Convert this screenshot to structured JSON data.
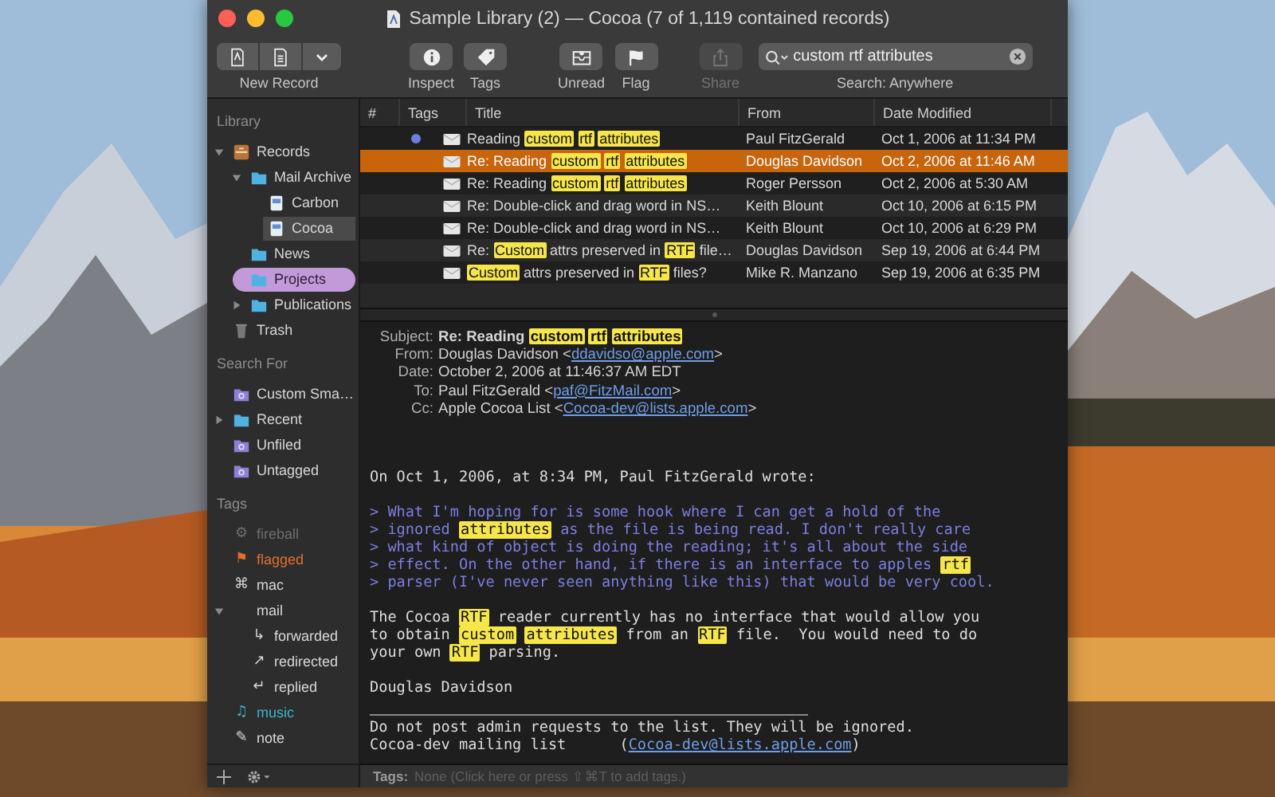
{
  "window": {
    "title": "Sample Library (2) — Cocoa (7 of 1,119 contained records)"
  },
  "toolbar": {
    "new_record": {
      "label": "New Record"
    },
    "buttons": [
      {
        "kind": "inspect",
        "label": "Inspect",
        "disabled": false
      },
      {
        "kind": "tags",
        "label": "Tags",
        "disabled": false
      },
      {
        "kind": "unread",
        "label": "Unread",
        "disabled": false
      },
      {
        "kind": "flag",
        "label": "Flag",
        "disabled": false
      },
      {
        "kind": "share",
        "label": "Share",
        "disabled": true
      }
    ],
    "search": {
      "value": "custom rtf attributes",
      "scope": "Search: Anywhere"
    }
  },
  "sidebar": {
    "sections": [
      {
        "title": "Library",
        "items": [
          {
            "label": "Records",
            "kind": "records",
            "expanded": true,
            "selected": false,
            "children": [
              {
                "label": "Mail Archive",
                "kind": "folder",
                "expanded": true,
                "selected": false,
                "children": [
                  {
                    "label": "Carbon",
                    "kind": "mailbox",
                    "selected": false
                  },
                  {
                    "label": "Cocoa",
                    "kind": "mailbox",
                    "selected": true
                  }
                ]
              },
              {
                "label": "News",
                "kind": "folder",
                "selected": false
              },
              {
                "label": "Projects",
                "kind": "folder",
                "selected": false,
                "color": "#c39ad9"
              },
              {
                "label": "Publications",
                "kind": "folder",
                "expanded": false,
                "selected": false
              }
            ]
          },
          {
            "label": "Trash",
            "kind": "trash",
            "selected": false
          }
        ]
      },
      {
        "title": "Search For",
        "items": [
          {
            "label": "Custom Sma…",
            "kind": "smart",
            "selected": false
          },
          {
            "label": "Recent",
            "kind": "folder",
            "expanded": false,
            "selected": false
          },
          {
            "label": "Unfiled",
            "kind": "smart",
            "selected": false
          },
          {
            "label": "Untagged",
            "kind": "smart",
            "selected": false
          }
        ]
      },
      {
        "title": "Tags",
        "items": [
          {
            "label": "fireball",
            "kind": "tag",
            "glyph": "⚙",
            "color": "#6e6e6e",
            "selected": false
          },
          {
            "label": "flagged",
            "kind": "tag",
            "glyph": "⚑",
            "color": "#e0702a",
            "selected": false
          },
          {
            "label": "mac",
            "kind": "tag",
            "glyph": "⌘",
            "color": "#d8d8d8",
            "selected": false
          },
          {
            "label": "mail",
            "kind": "tag",
            "color": "#d8d8d8",
            "expanded": true,
            "selected": false,
            "children": [
              {
                "label": "forwarded",
                "kind": "tag",
                "glyph": "↳",
                "color": "#d8d8d8",
                "selected": false
              },
              {
                "label": "redirected",
                "kind": "tag",
                "glyph": "↗",
                "color": "#d8d8d8",
                "selected": false
              },
              {
                "label": "replied",
                "kind": "tag",
                "glyph": "↵",
                "color": "#d8d8d8",
                "selected": false
              }
            ]
          },
          {
            "label": "music",
            "kind": "tag",
            "glyph": "♫",
            "color": "#3bb8c9",
            "selected": false
          },
          {
            "label": "note",
            "kind": "tag",
            "glyph": "✎",
            "color": "#d8d8d8",
            "selected": false
          }
        ]
      }
    ]
  },
  "table": {
    "columns": [
      "#",
      "Tags",
      "Title",
      "From",
      "Date Modified"
    ],
    "rows": [
      {
        "unread": true,
        "selected": false,
        "title": [
          {
            "text": "Reading ",
            "kind": "plain"
          },
          {
            "text": "custom ",
            "kind": "highlight"
          },
          {
            "text": "rtf ",
            "kind": "highlight"
          },
          {
            "text": "attributes",
            "kind": "highlight"
          }
        ],
        "from": "Paul FitzGerald",
        "date": "Oct 1, 2006 at 11:34 PM"
      },
      {
        "unread": false,
        "selected": true,
        "title": [
          {
            "text": "Re: Reading ",
            "kind": "plain"
          },
          {
            "text": "custom ",
            "kind": "highlight"
          },
          {
            "text": "rtf ",
            "kind": "highlight"
          },
          {
            "text": "attributes",
            "kind": "highlight"
          }
        ],
        "from": "Douglas Davidson",
        "date": "Oct 2, 2006 at 11:46 AM"
      },
      {
        "unread": false,
        "selected": false,
        "title": [
          {
            "text": "Re: Reading ",
            "kind": "plain"
          },
          {
            "text": "custom ",
            "kind": "highlight"
          },
          {
            "text": "rtf ",
            "kind": "highlight"
          },
          {
            "text": "attributes",
            "kind": "highlight"
          }
        ],
        "from": "Roger Persson",
        "date": "Oct 2, 2006 at 5:30 AM"
      },
      {
        "unread": false,
        "selected": false,
        "title": [
          {
            "text": "Re: Double-click and drag word in NS…",
            "kind": "plain"
          }
        ],
        "from": "Keith Blount",
        "date": "Oct 10, 2006 at 6:15 PM"
      },
      {
        "unread": false,
        "selected": false,
        "title": [
          {
            "text": "Re: Double-click and drag word in NS…",
            "kind": "plain"
          }
        ],
        "from": "Keith Blount",
        "date": "Oct 10, 2006 at 6:29 PM"
      },
      {
        "unread": false,
        "selected": false,
        "title": [
          {
            "text": "Re: ",
            "kind": "plain"
          },
          {
            "text": "Custom",
            "kind": "highlight"
          },
          {
            "text": " attrs preserved in ",
            "kind": "plain"
          },
          {
            "text": "RTF",
            "kind": "highlight"
          },
          {
            "text": " file…",
            "kind": "plain"
          }
        ],
        "from": "Douglas Davidson",
        "date": "Sep 19, 2006 at 6:44 PM"
      },
      {
        "unread": false,
        "selected": false,
        "title": [
          {
            "text": "Custom",
            "kind": "highlight"
          },
          {
            "text": " attrs preserved in ",
            "kind": "plain"
          },
          {
            "text": "RTF",
            "kind": "highlight"
          },
          {
            "text": " files?",
            "kind": "plain"
          }
        ],
        "from": "Mike R. Manzano",
        "date": "Sep 19, 2006 at 6:35 PM"
      }
    ]
  },
  "message": {
    "headers": [
      {
        "kind": "subject",
        "label": "Subject:",
        "value": [
          {
            "text": "Re: Reading ",
            "kind": "plain"
          },
          {
            "text": "custom ",
            "kind": "highlight"
          },
          {
            "text": "rtf ",
            "kind": "highlight"
          },
          {
            "text": "attributes",
            "kind": "highlight"
          }
        ]
      },
      {
        "kind": "address",
        "label": "From:",
        "value": [
          {
            "text": "Douglas Davidson <",
            "kind": "plain"
          },
          {
            "text": "ddavidso@apple.com",
            "kind": "link"
          },
          {
            "text": ">",
            "kind": "plain"
          }
        ]
      },
      {
        "kind": "date",
        "label": "Date:",
        "value": [
          {
            "text": "October 2, 2006 at 11:46:37 AM EDT",
            "kind": "plain"
          }
        ]
      },
      {
        "kind": "address",
        "label": "To:",
        "value": [
          {
            "text": "Paul FitzGerald <",
            "kind": "plain"
          },
          {
            "text": "paf@FitzMail.com",
            "kind": "link"
          },
          {
            "text": ">",
            "kind": "plain"
          }
        ]
      },
      {
        "kind": "address",
        "label": "Cc:",
        "value": [
          {
            "text": "Apple Cocoa List <",
            "kind": "plain"
          },
          {
            "text": "Cocoa-dev@lists.apple.com",
            "kind": "link"
          },
          {
            "text": ">",
            "kind": "plain"
          }
        ]
      }
    ],
    "body": [
      {
        "kind": "text",
        "lines": [
          [
            {
              "text": "On Oct 1, 2006, at 8:34 PM, Paul FitzGerald wrote:",
              "kind": "plain"
            }
          ]
        ]
      },
      {
        "kind": "quote",
        "lines": [
          [
            {
              "text": "> What I'm hoping for is some hook where I can get a hold of the",
              "kind": "plain"
            }
          ],
          [
            {
              "text": "> ignored ",
              "kind": "plain"
            },
            {
              "text": "attributes",
              "kind": "highlight"
            },
            {
              "text": " as the file is being read. I don't really care",
              "kind": "plain"
            }
          ],
          [
            {
              "text": "> what kind of object is doing the reading; it's all about the side",
              "kind": "plain"
            }
          ],
          [
            {
              "text": "> effect. On the other hand, if there is an interface to apples ",
              "kind": "plain"
            },
            {
              "text": "rtf",
              "kind": "highlight"
            }
          ],
          [
            {
              "text": "> parser (I've never seen anything like this) that would be very cool.",
              "kind": "plain"
            }
          ]
        ]
      },
      {
        "kind": "text",
        "lines": [
          [
            {
              "text": "The Cocoa ",
              "kind": "plain"
            },
            {
              "text": "RTF",
              "kind": "highlight"
            },
            {
              "text": " reader currently has no interface that would allow you",
              "kind": "plain"
            }
          ],
          [
            {
              "text": "to obtain ",
              "kind": "plain"
            },
            {
              "text": "custom ",
              "kind": "highlight"
            },
            {
              "text": "attributes",
              "kind": "highlight"
            },
            {
              "text": " from an ",
              "kind": "plain"
            },
            {
              "text": "RTF",
              "kind": "highlight"
            },
            {
              "text": " file.  You would need to do",
              "kind": "plain"
            }
          ],
          [
            {
              "text": "your own ",
              "kind": "plain"
            },
            {
              "text": "RTF",
              "kind": "highlight"
            },
            {
              "text": " parsing.",
              "kind": "plain"
            }
          ]
        ]
      },
      {
        "kind": "text",
        "lines": [
          [
            {
              "text": "Douglas Davidson",
              "kind": "plain"
            }
          ]
        ]
      },
      {
        "kind": "footer",
        "lines": [
          [
            {
              "text": "Do not post admin requests to the list. They will be ignored.",
              "kind": "plain"
            }
          ],
          [
            {
              "text": "Cocoa-dev mailing list      (",
              "kind": "plain"
            },
            {
              "text": "Cocoa-dev@lists.apple.com",
              "kind": "link"
            },
            {
              "text": ")",
              "kind": "plain"
            }
          ]
        ]
      }
    ]
  },
  "tags_bar": {
    "label": "Tags:",
    "placeholder": "None (Click here or press ⇧⌘T to add tags.)"
  }
}
